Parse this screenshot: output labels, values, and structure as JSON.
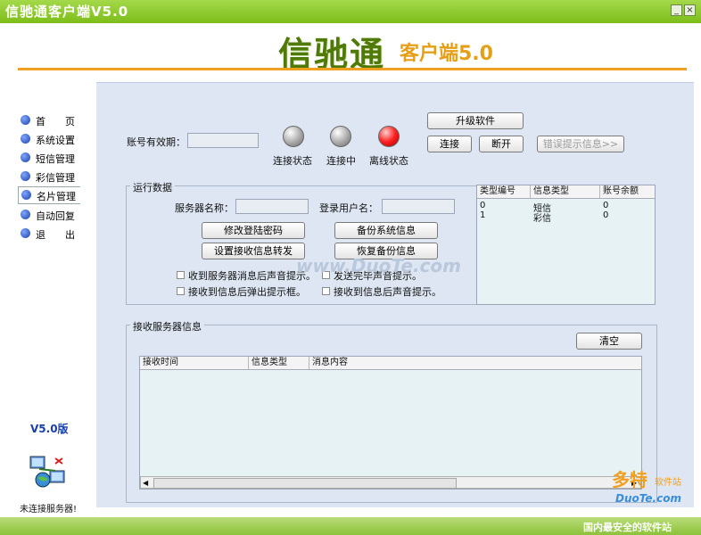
{
  "window": {
    "title": "信驰通客户端V5.0",
    "min": "_",
    "close": "×"
  },
  "header": {
    "brand": "信驰通",
    "subtitle": "客户端5.0"
  },
  "nav": {
    "items": [
      {
        "label": "首　　页"
      },
      {
        "label": "系统设置"
      },
      {
        "label": "短信管理"
      },
      {
        "label": "彩信管理"
      },
      {
        "label": "名片管理"
      },
      {
        "label": "自动回复"
      },
      {
        "label": "退　　出"
      }
    ],
    "active_index": 4,
    "version": "V5.0版",
    "server_status": "未连接服务器!"
  },
  "account": {
    "label": "账号有效期：",
    "value": ""
  },
  "status_lights": [
    {
      "label": "连接状态",
      "color": "gray"
    },
    {
      "label": "连接中",
      "color": "gray"
    },
    {
      "label": "离线状态",
      "color": "red"
    }
  ],
  "toolbar": {
    "upgrade": "升级软件",
    "connect": "连接",
    "disconnect": "断开",
    "error_info": "错误提示信息>>"
  },
  "runtime": {
    "title": "运行数据",
    "server_name_label": "服务器名称：",
    "server_name_value": "",
    "login_user_label": "登录用户名：",
    "login_user_value": "",
    "buttons": {
      "change_password": "修改登陆密码",
      "backup": "备份系统信息",
      "set_forward": "设置接收信息转发",
      "restore": "恢复备份信息"
    },
    "options": [
      {
        "label": "收到服务器消息后声音提示。",
        "checked": false
      },
      {
        "label": "发送完毕声音提示。",
        "checked": false
      },
      {
        "label": "接收到信息后弹出提示框。",
        "checked": false
      },
      {
        "label": "接收到信息后声音提示。",
        "checked": false
      }
    ]
  },
  "balance_table": {
    "columns": [
      "类型编号",
      "信息类型",
      "账号余额"
    ],
    "rows": [
      {
        "type_id": "0",
        "info_type": "短信",
        "balance": "0"
      },
      {
        "type_id": "1",
        "info_type": "彩信",
        "balance": "0"
      }
    ]
  },
  "receive": {
    "title": "接收服务器信息",
    "clear": "清空",
    "columns": [
      "接收时间",
      "信息类型",
      "消息内容"
    ]
  },
  "watermarks": {
    "center": "www.DuoTe.com",
    "corner_brand": "多特",
    "corner_sub": "软件站",
    "corner_site": "DuoTe.com",
    "corner_slogan": "国内最安全的软件站"
  }
}
